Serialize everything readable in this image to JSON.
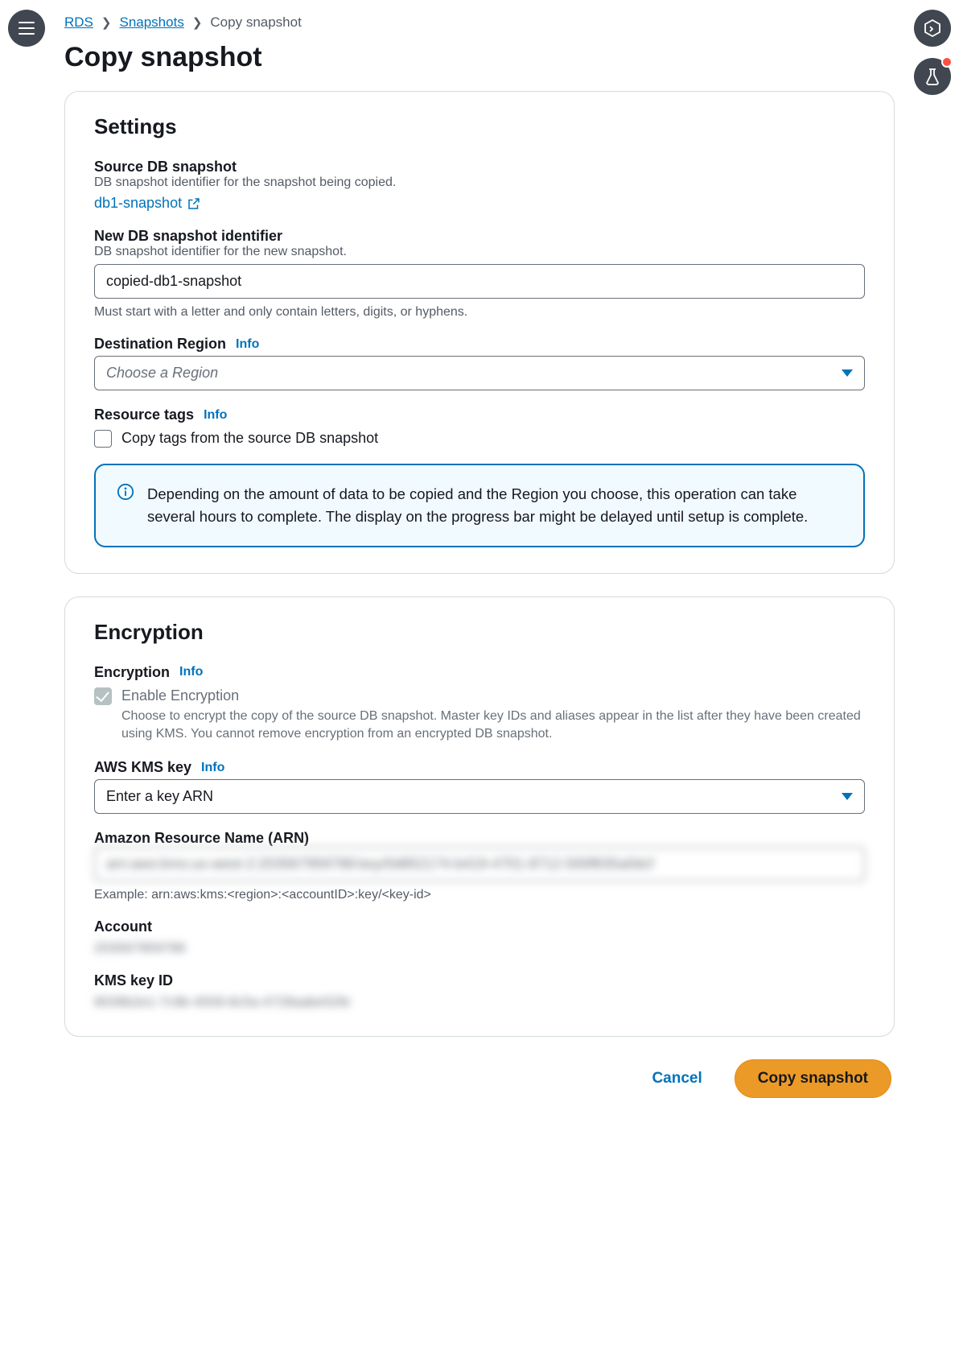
{
  "breadcrumb": {
    "rds": "RDS",
    "snapshots": "Snapshots",
    "current": "Copy snapshot"
  },
  "page_title": "Copy snapshot",
  "info_label": "Info",
  "settings": {
    "heading": "Settings",
    "source": {
      "label": "Source DB snapshot",
      "desc": "DB snapshot identifier for the snapshot being copied.",
      "link_text": "db1-snapshot"
    },
    "new_id": {
      "label": "New DB snapshot identifier",
      "desc": "DB snapshot identifier for the new snapshot.",
      "value": "copied-db1-snapshot",
      "hint": "Must start with a letter and only contain letters, digits, or hyphens."
    },
    "region": {
      "label": "Destination Region",
      "placeholder": "Choose a Region"
    },
    "tags": {
      "label": "Resource tags",
      "checkbox_label": "Copy tags from the source DB snapshot"
    },
    "alert": "Depending on the amount of data to be copied and the Region you choose, this operation can take several hours to complete. The display on the progress bar might be delayed until setup is complete."
  },
  "encryption": {
    "heading": "Encryption",
    "section_label": "Encryption",
    "enable_label": "Enable Encryption",
    "enable_desc": "Choose to encrypt the copy of the source DB snapshot. Master key IDs and aliases appear in the list after they have been created using KMS. You cannot remove encryption from an encrypted DB snapshot.",
    "kms": {
      "label": "AWS KMS key",
      "selected": "Enter a key ARN"
    },
    "arn": {
      "label": "Amazon Resource Name (ARN)",
      "value": "arn:aws:kms:us-west-2:203567959788:key/0d852174-b419-4701-8712-500f835a0dcf",
      "example": "Example: arn:aws:kms:<region>:<accountID>:key/<key-id>"
    },
    "account": {
      "label": "Account",
      "value": "203567959788"
    },
    "key_id": {
      "label": "KMS key ID",
      "value": "8039b2e1-7c9b-4559-8c5a-4728aabe52fe"
    }
  },
  "actions": {
    "cancel": "Cancel",
    "submit": "Copy snapshot"
  }
}
